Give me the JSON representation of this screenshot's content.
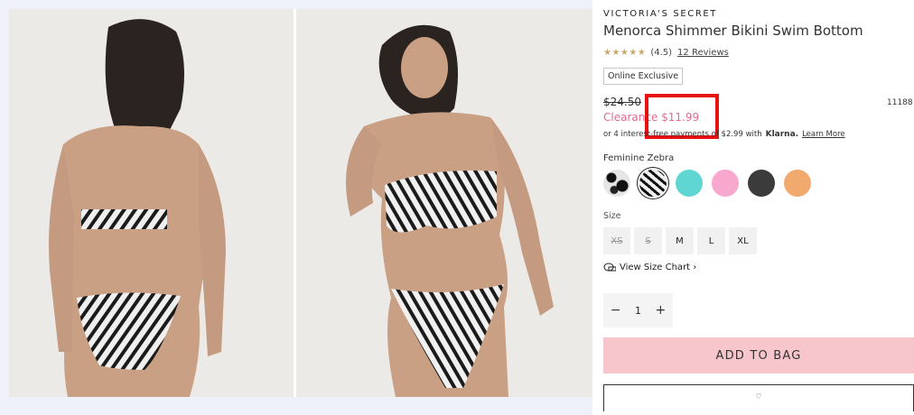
{
  "product": {
    "brand": "VICTORIA'S SECRET",
    "title": "Menorca Shimmer Bikini Swim Bottom",
    "rating_stars": "★★★★★",
    "rating_value": "(4.5)",
    "reviews_link": "12 Reviews",
    "badge": "Online Exclusive",
    "original_price": "$24.50",
    "item_number": "11188",
    "clearance_price": "Clearance $11.99",
    "klarna_text": "or 4 interest-free payments of $2.99 with",
    "klarna_brand": "Klarna.",
    "learn_more": "Learn More",
    "color_label": "Feminine Zebra",
    "swatch_colors": [
      "#e2e2e2",
      "#ffffff",
      "#5fd6d2",
      "#f7a8cc",
      "#3b3b3b",
      "#f2a96e"
    ],
    "size_label": "Size",
    "sizes": [
      "XS",
      "S",
      "M",
      "L",
      "XL"
    ],
    "size_chart": "View Size Chart ›",
    "quantity": "1",
    "qty_minus": "−",
    "qty_plus": "+",
    "add_to_bag": "ADD TO BAG",
    "wishlist_partial": "♡"
  },
  "colors": {
    "accent_pink": "#e06c92",
    "add_bag_bg": "#f7c5cc",
    "highlight_red": "#e81010"
  }
}
